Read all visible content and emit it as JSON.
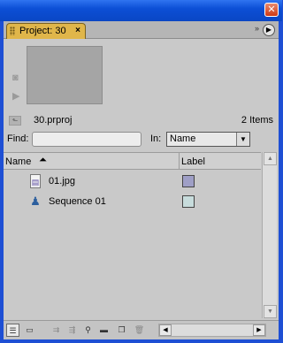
{
  "window": {
    "close_glyph": "✕"
  },
  "tab": {
    "title": "Project: 30",
    "close_glyph": "×"
  },
  "panel_menu": {
    "glyph": "▶",
    "dbl": "»"
  },
  "project": {
    "name": "30.prproj",
    "item_count": "2 Items"
  },
  "search": {
    "label": "Find:",
    "value": "",
    "placeholder": ""
  },
  "in_filter": {
    "label": "In:",
    "selected": "Name",
    "arrow": "▼"
  },
  "columns": {
    "name": "Name",
    "sort_arrow": "⏶",
    "label": "Label"
  },
  "items": [
    {
      "name": "01.jpg",
      "icon": "image-file-icon",
      "label_color": "#9f9fc6"
    },
    {
      "name": "Sequence 01",
      "icon": "sequence-icon",
      "label_color": "#c7dcdc"
    }
  ],
  "colors": {
    "accent": "#e0b64a",
    "panel_bg": "#c9c9c9"
  }
}
